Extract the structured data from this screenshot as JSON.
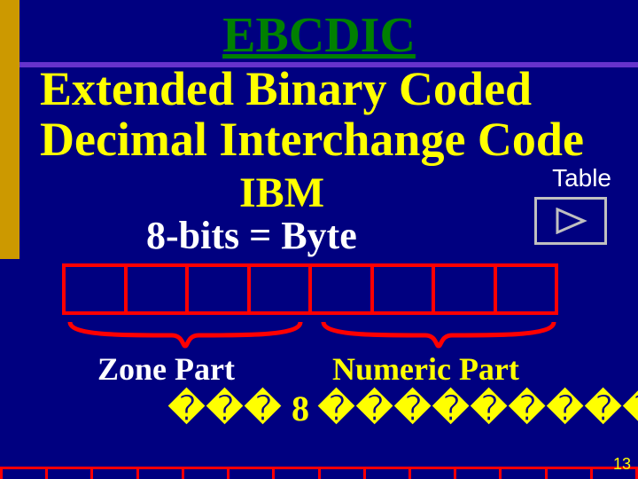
{
  "title": "EBCDIC",
  "subtitle": "Extended  Binary  Coded  Decimal  Interchange  Code",
  "vendor": "IBM",
  "table_label": "Table",
  "bits_line": "8-bits  =  Byte",
  "byte": {
    "bit_count": 8
  },
  "zone_label": "Zone  Part",
  "numeric_label": "Numeric  Part",
  "bottom_glyph_left": "���",
  "bottom_middle": " 8 ",
  "bottom_glyph_right": "���������",
  "page_number": "13",
  "edge_cells": 14
}
